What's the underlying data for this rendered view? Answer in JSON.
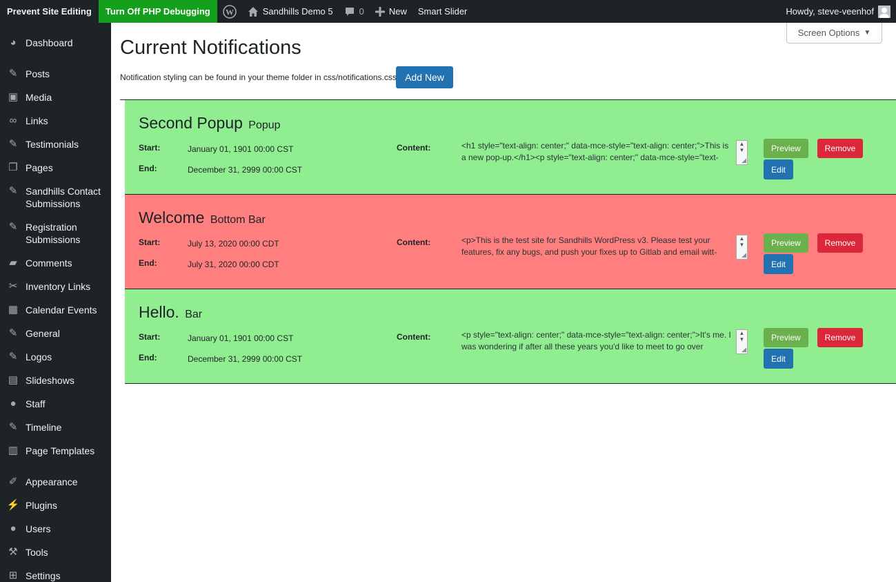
{
  "admin_bar": {
    "prevent_editing": "Prevent Site Editing",
    "php_debugging": "Turn Off PHP Debugging",
    "site_name": "Sandhills Demo 5",
    "comments_count": "0",
    "new_label": "New",
    "smart_slider": "Smart Slider",
    "howdy": "Howdy, steve-veenhof"
  },
  "sidebar": {
    "items": [
      {
        "label": "Dashboard",
        "icon": "dashboard-icon"
      },
      {
        "label": "Posts",
        "icon": "pin-icon"
      },
      {
        "label": "Media",
        "icon": "media-icon"
      },
      {
        "label": "Links",
        "icon": "link-icon"
      },
      {
        "label": "Testimonials",
        "icon": "pin-icon"
      },
      {
        "label": "Pages",
        "icon": "pages-icon"
      },
      {
        "label": "Sandhills Contact Submissions",
        "icon": "pin-icon"
      },
      {
        "label": "Registration Submissions",
        "icon": "pin-icon"
      },
      {
        "label": "Comments",
        "icon": "comment-icon"
      },
      {
        "label": "Inventory Links",
        "icon": "unlink-icon"
      },
      {
        "label": "Calendar Events",
        "icon": "calendar-icon"
      },
      {
        "label": "General",
        "icon": "pin-icon"
      },
      {
        "label": "Logos",
        "icon": "pin-icon"
      },
      {
        "label": "Slideshows",
        "icon": "slides-icon"
      },
      {
        "label": "Staff",
        "icon": "person-icon"
      },
      {
        "label": "Timeline",
        "icon": "pin-icon"
      },
      {
        "label": "Page Templates",
        "icon": "layout-icon"
      },
      {
        "label": "Appearance",
        "icon": "brush-icon"
      },
      {
        "label": "Plugins",
        "icon": "plug-icon"
      },
      {
        "label": "Users",
        "icon": "users-icon"
      },
      {
        "label": "Tools",
        "icon": "wrench-icon"
      },
      {
        "label": "Settings",
        "icon": "settings-icon"
      }
    ]
  },
  "screen_options": "Screen Options",
  "page": {
    "title": "Current Notifications",
    "intro": "Notification styling can be found in your theme folder in css/notifications.css",
    "add_new": "Add New"
  },
  "labels": {
    "start": "Start:",
    "end": "End:",
    "content": "Content:",
    "preview": "Preview",
    "remove": "Remove",
    "edit": "Edit"
  },
  "notifications": [
    {
      "title": "Second Popup",
      "type": "Popup",
      "start": "January 01, 1901 00:00 CST",
      "end": "December 31, 2999 00:00 CST",
      "content": "<h1 style=\"text-align: center;\" data-mce-style=\"text-align: center;\">This is a new pop-up.</h1><p style=\"text-align: center;\" data-mce-style=\"text-",
      "color": "#90ee90"
    },
    {
      "title": "Welcome",
      "type": "Bottom Bar",
      "start": "July 13, 2020 00:00 CDT",
      "end": "July 31, 2020 00:00 CDT",
      "content": "<p>This is the test site for Sandhills WordPress v3. Please test your features, fix any bugs, and push your fixes up to Gitlab and email witt-",
      "color": "#ff7f7f"
    },
    {
      "title": "Hello.",
      "type": "Bar",
      "start": "January 01, 1901 00:00 CST",
      "end": "December 31, 2999 00:00 CST",
      "content": "<p style=\"text-align: center;\" data-mce-style=\"text-align: center;\">It's me. I was wondering if after all these years you'd like to meet to go over",
      "color": "#90ee90"
    }
  ]
}
